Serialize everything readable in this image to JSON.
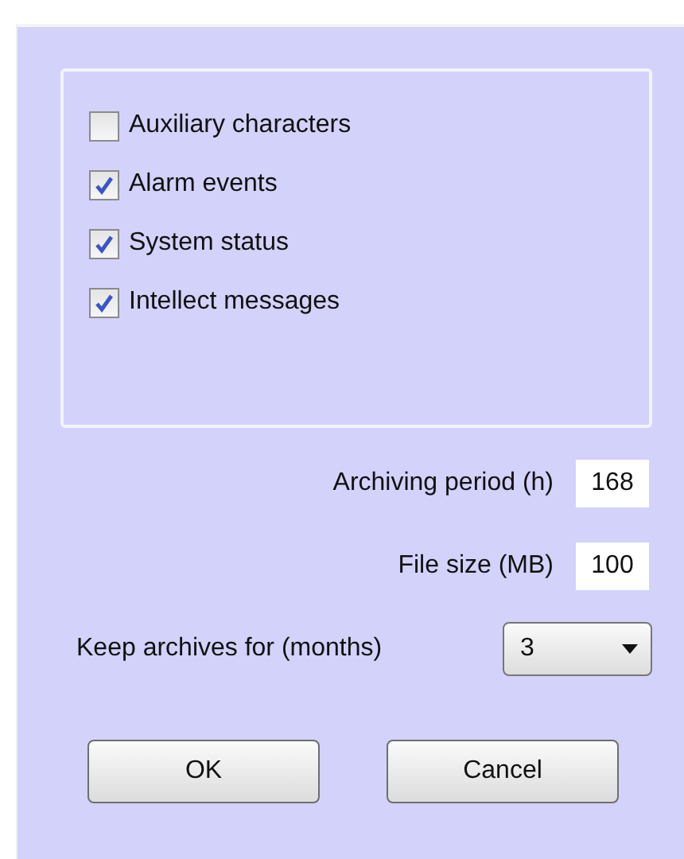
{
  "options": [
    {
      "label": "Auxiliary characters",
      "checked": false
    },
    {
      "label": "Alarm events",
      "checked": true
    },
    {
      "label": "System status",
      "checked": true
    },
    {
      "label": "Intellect messages",
      "checked": true
    }
  ],
  "fields": [
    {
      "label": "Archiving period (h)",
      "value": "168"
    },
    {
      "label": "File size (MB)",
      "value": "100"
    }
  ],
  "keep_archives": {
    "label": "Keep archives for (months)",
    "value": "3"
  },
  "buttons": [
    "OK",
    "Cancel"
  ]
}
